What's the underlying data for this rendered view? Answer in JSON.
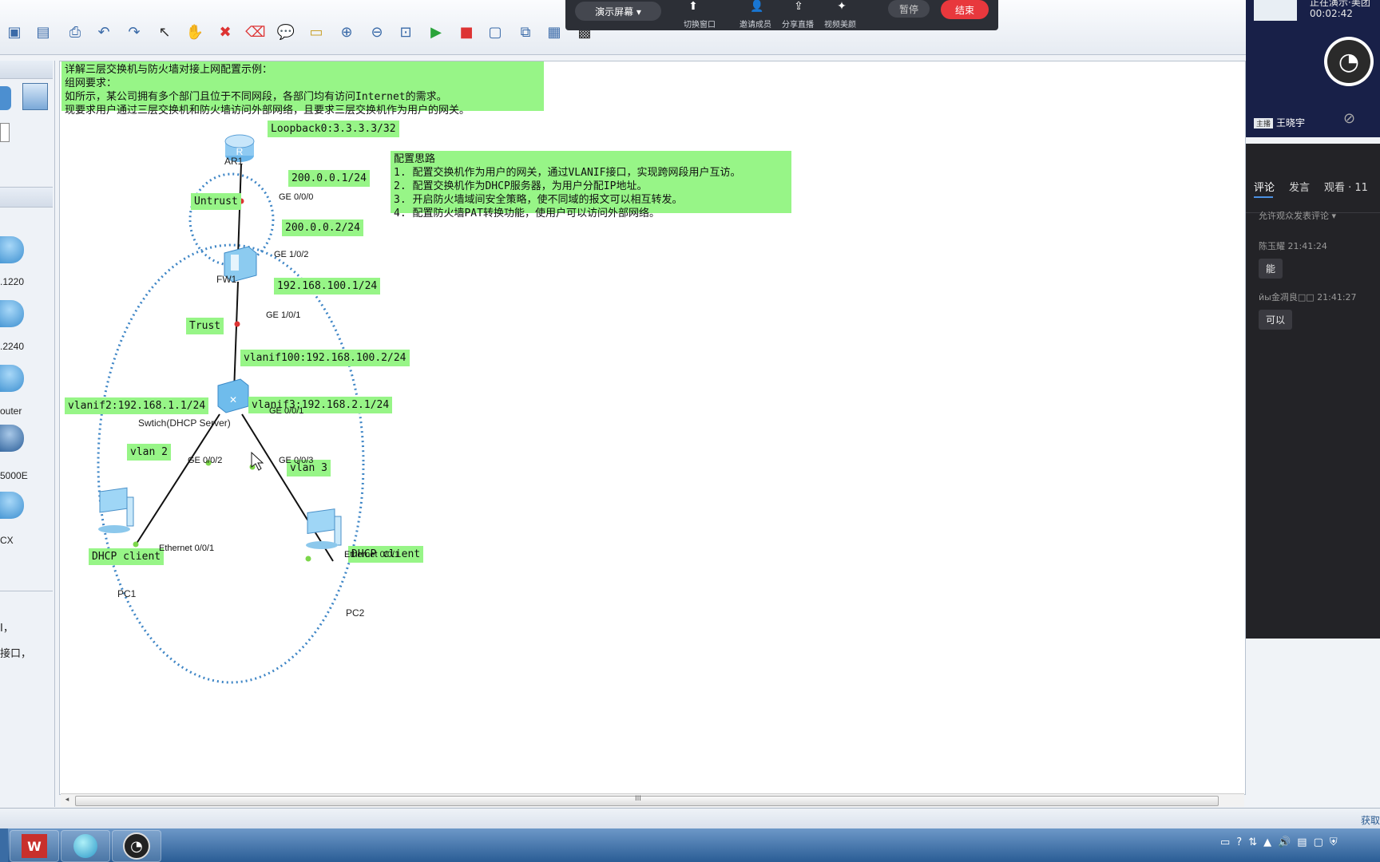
{
  "presentation_bar": {
    "mode_label": "演示屏幕 ▾",
    "switch_window": "切换窗口",
    "invite": "邀请成员",
    "share": "分享直播",
    "beauty": "视频美颜",
    "pause": "暂停",
    "end": "结束"
  },
  "live_panel": {
    "status": "正在演示·美团",
    "timer": "00:02:42",
    "host_badge": "主播",
    "host_name": "王晓宇",
    "tabs": [
      "评论",
      "发言",
      "观看 · 11"
    ],
    "comment_setting": "允许观众发表评论 ▾",
    "comments": [
      {
        "user": "陈玉耀",
        "time": "21:41:24",
        "text": "能"
      },
      {
        "user": "йы金凋良□□",
        "time": "21:41:27",
        "text": "可以"
      }
    ]
  },
  "left_panel": {
    "labels": [
      ".1220",
      ".2240",
      "outer",
      "5000E",
      "CX"
    ],
    "text_lines": [
      "I，",
      "接口，"
    ]
  },
  "canvas": {
    "intro_note": "详解三层交换机与防火墙对接上网配置示例：\n组网要求：\n如所示，某公司拥有多个部门且位于不同网段，各部门均有访问Internet的需求。\n现要求用户通过三层交换机和防火墙访问外部网络，且要求三层交换机作为用户的网关。",
    "config_note": "配置思路\n1. 配置交换机作为用户的网关，通过VLANIF接口，实现跨网段用户互访。\n2. 配置交换机作为DHCP服务器，为用户分配IP地址。\n3. 开启防火墙域间安全策略，使不同域的报文可以相互转发。\n4. 配置防火墙PAT转换功能，使用户可以访问外部网络。",
    "notes": {
      "loopback": "Loopback0:3.3.3.3/32",
      "ar1_ge000": "200.0.0.1/24",
      "untrust": "Untrust",
      "fw_ge102": "200.0.0.2/24",
      "fw_ge101": "192.168.100.1/24",
      "trust": "Trust",
      "vlanif100": "vlanif100:192.168.100.2/24",
      "vlanif2": "vlanif2:192.168.1.1/24",
      "vlanif3": "vlanif3:192.168.2.1/24",
      "vlan2": "vlan 2",
      "vlan3": "vlan 3",
      "dhcp1": "DHCP client",
      "dhcp2": "DHCP client"
    },
    "devices": {
      "ar1": "AR1",
      "fw1": "FW1",
      "switch": "Swtich(DHCP Server)",
      "pc1": "PC1",
      "pc2": "PC2"
    },
    "ports": {
      "ar1_ge000": "GE 0/0/0",
      "fw_ge102": "GE 1/0/2",
      "fw_ge101": "GE 1/0/1",
      "sw_ge001": "GE 0/0/1",
      "sw_ge002": "GE 0/0/2",
      "sw_ge003": "GE 0/0/3",
      "pc1_eth": "Ethernet 0/0/1",
      "pc2_eth": "Ethernet 0/0/1"
    }
  },
  "hscroll": {
    "grip": "III"
  },
  "status_bar": {
    "right_text": "获取"
  },
  "colors": {
    "note_bg": "#97f587",
    "zone_dot": "#3f86c6",
    "end_btn": "#e8383d"
  }
}
